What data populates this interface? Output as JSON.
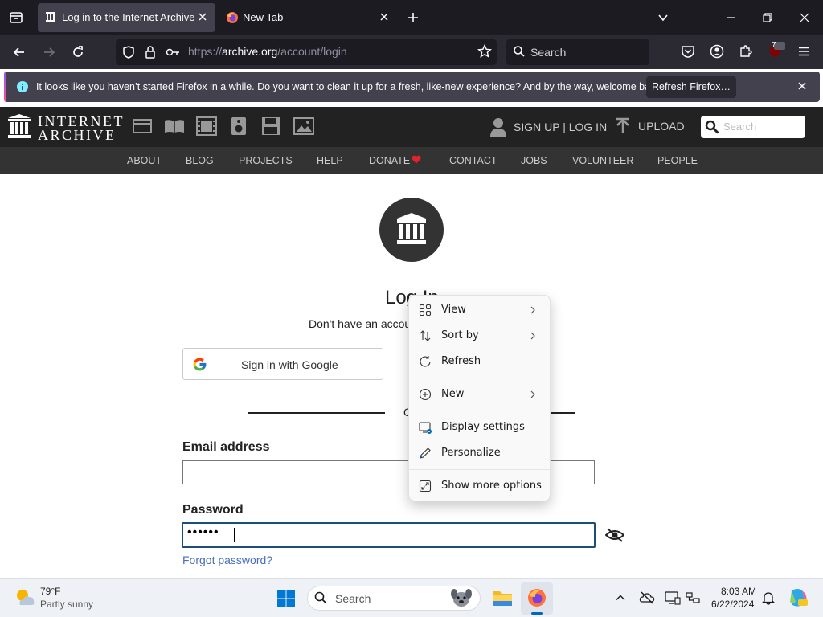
{
  "browser": {
    "tabs": [
      {
        "title": "Log in to the Internet Archive",
        "active": true
      },
      {
        "title": "New Tab",
        "active": false
      }
    ],
    "url": {
      "prefix": "https://",
      "domain": "archive.org",
      "path": "/account/login"
    },
    "search_placeholder": "Search",
    "extension_badge": "7",
    "notification": {
      "message": "It looks like you haven’t started Firefox in a while. Do you want to clean it up for a fresh, like-new experience? And by the way, welcome back!",
      "button": "Refresh Firefox…"
    }
  },
  "site": {
    "logo_line1": "INTERNET",
    "logo_line2": "ARCHIVE",
    "media_icons": [
      "web-icon",
      "texts-icon",
      "video-icon",
      "audio-icon",
      "software-icon",
      "images-icon"
    ],
    "signup_login": "SIGN UP | LOG IN",
    "upload": "UPLOAD",
    "search_placeholder": "Search",
    "nav": [
      "ABOUT",
      "BLOG",
      "PROJECTS",
      "HELP",
      "DONATE",
      "CONTACT",
      "JOBS",
      "VOLUNTEER",
      "PEOPLE"
    ]
  },
  "login": {
    "title": "Log In",
    "no_account": "Don't have an account?",
    "google_button": "Sign in with Google",
    "or_text": "OR",
    "email_label": "Email address",
    "email_value": "",
    "password_label": "Password",
    "password_value": "••••••",
    "forgot": "Forgot password?"
  },
  "context_menu": {
    "items": [
      {
        "label": "View",
        "icon": "grid-icon",
        "submenu": true
      },
      {
        "label": "Sort by",
        "icon": "sort-icon",
        "submenu": true
      },
      {
        "label": "Refresh",
        "icon": "refresh-icon",
        "submenu": false
      },
      {
        "label": "New",
        "icon": "plus-circle-icon",
        "submenu": true
      },
      {
        "label": "Display settings",
        "icon": "display-settings-icon",
        "submenu": false
      },
      {
        "label": "Personalize",
        "icon": "pen-icon",
        "submenu": false
      },
      {
        "label": "Show more options",
        "icon": "expand-icon",
        "submenu": false
      }
    ]
  },
  "taskbar": {
    "weather_temp": "79°F",
    "weather_condition": "Partly sunny",
    "search_placeholder": "Search",
    "time": "8:03 AM",
    "date": "6/22/2024"
  },
  "colors": {
    "firefox_dark": "#1c1b22",
    "firefox_toolbar": "#2b2a33",
    "ia_header": "#222222",
    "ia_nav": "#333333",
    "donate_heart": "#e4222a",
    "link_blue": "#4a6ebd",
    "focus_border": "#1e4d78"
  }
}
